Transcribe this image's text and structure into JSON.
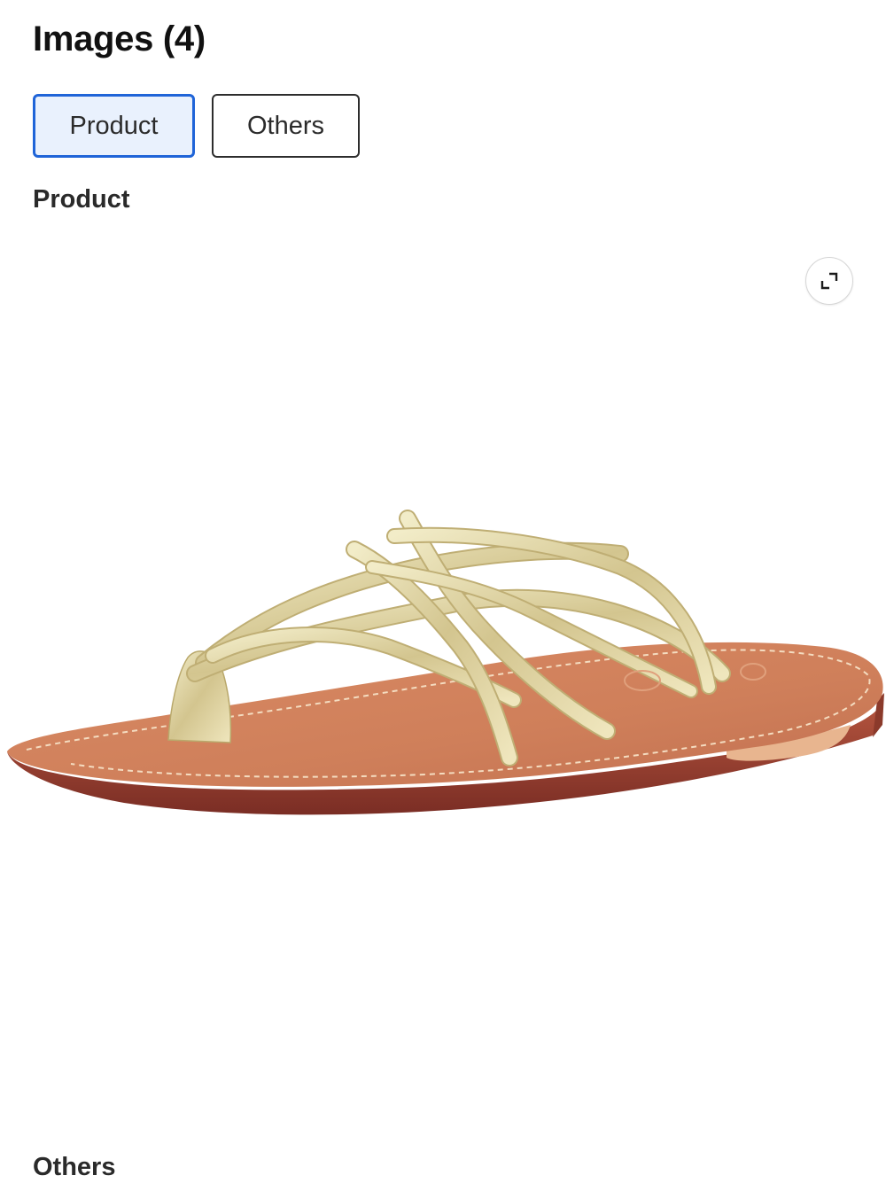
{
  "header": {
    "title": "Images (4)"
  },
  "tabs": [
    {
      "label": "Product",
      "selected": true
    },
    {
      "label": "Others",
      "selected": false
    }
  ],
  "sections": {
    "product_title": "Product",
    "others_title": "Others"
  },
  "product_image": {
    "subject": "gold metallic strappy thong flat sandal with tan footbed",
    "icon": "expand-icon"
  },
  "colors": {
    "selected_tab_border": "#1f64d8",
    "selected_tab_bg": "#e9f1fd",
    "text": "#111111"
  }
}
